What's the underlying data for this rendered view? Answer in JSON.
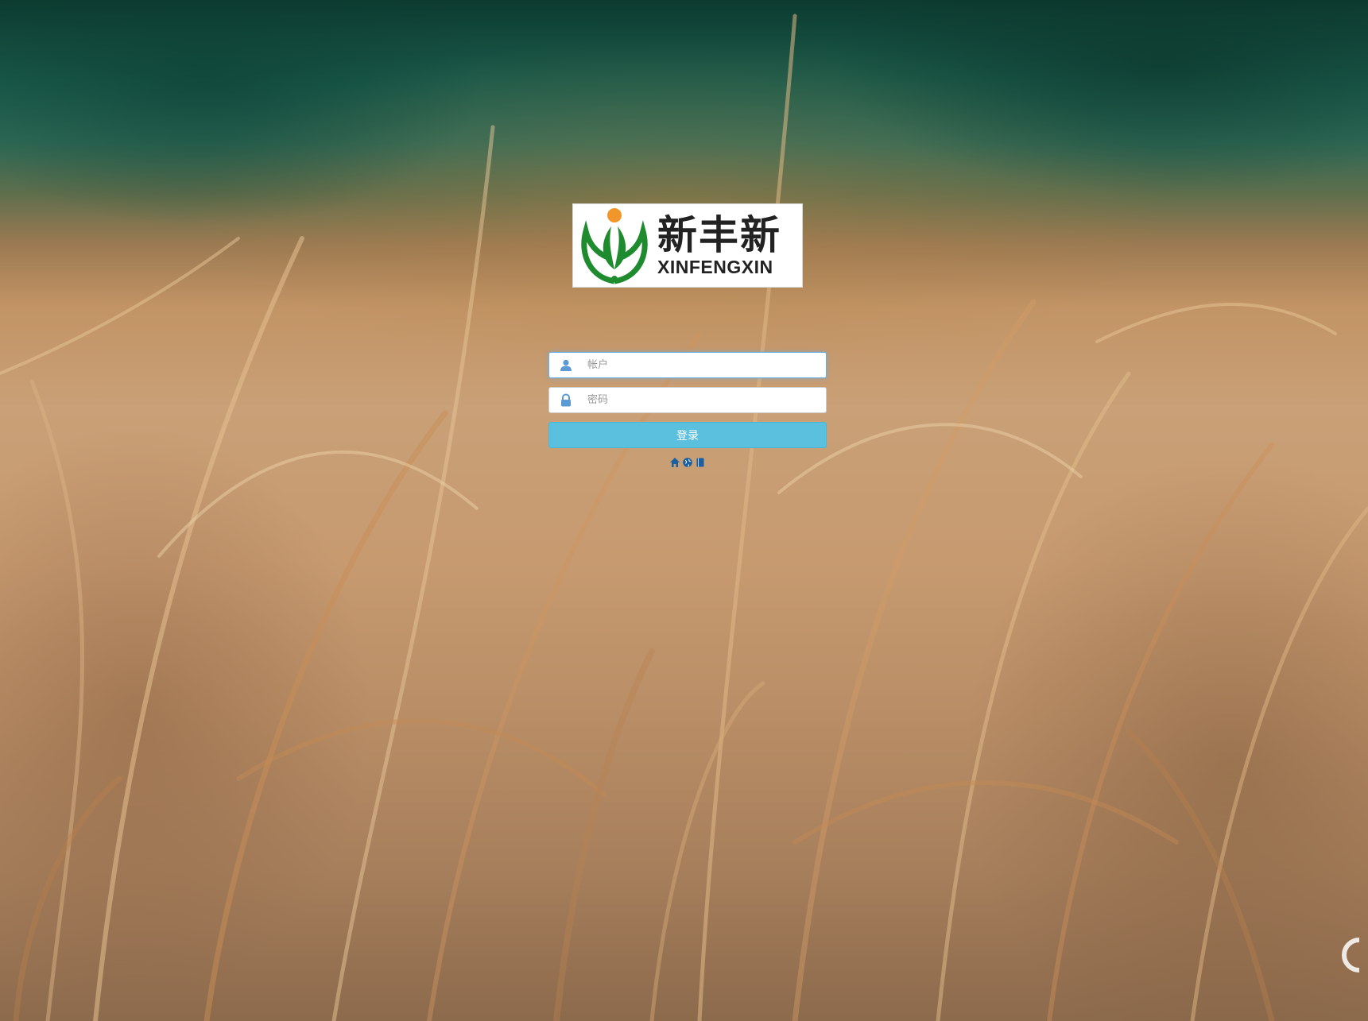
{
  "brand": {
    "name_cn": "新丰新",
    "name_en": "XINFENGXIN",
    "colors": {
      "leaf": "#1e8b2f",
      "sun": "#f0962a"
    }
  },
  "login": {
    "account_placeholder": "帐户",
    "password_placeholder": "密码",
    "account_value": "",
    "password_value": "",
    "submit_label": "登录"
  },
  "footer_links": [
    {
      "icon": "home-icon"
    },
    {
      "icon": "globe-icon"
    },
    {
      "icon": "book-icon"
    }
  ],
  "colors": {
    "button": "#5bc0de",
    "focus_border": "#66afe9",
    "link_icon": "#1a5fa0"
  }
}
